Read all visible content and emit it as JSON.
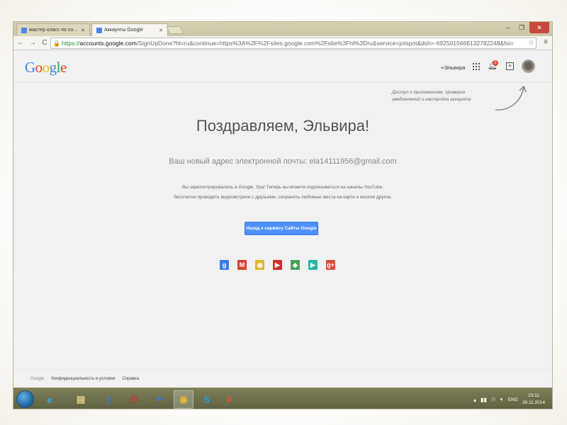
{
  "browser": {
    "tabs": [
      {
        "label": "мастер класс по создан",
        "active": false
      },
      {
        "label": "Аккаунты Google",
        "active": true
      }
    ],
    "window_controls": {
      "minimize": "–",
      "maximize": "❐",
      "close": "✕"
    },
    "nav": {
      "back": "←",
      "forward": "→",
      "reload": "C"
    },
    "address": {
      "scheme": "https://",
      "host": "accounts.google.com",
      "rest": "/SignUpDone?hl=ru&continue=https%3A%2F%2Fsites.google.com%2Fsite%3Fhl%3Dru&service=jotspot&dsh=-6925015666132782248&fvi="
    }
  },
  "header": {
    "logo_letters": [
      {
        "ch": "G",
        "color": "#4285f4"
      },
      {
        "ch": "o",
        "color": "#ea4335"
      },
      {
        "ch": "o",
        "color": "#fbbc05"
      },
      {
        "ch": "g",
        "color": "#4285f4"
      },
      {
        "ch": "l",
        "color": "#34a853"
      },
      {
        "ch": "e",
        "color": "#ea4335"
      }
    ],
    "user_link": "+Эльвира",
    "notification_count": "3"
  },
  "hint": {
    "line1": "Доступ к приложениям, проверка",
    "line2": "уведомлений и настройка аккаунта"
  },
  "main": {
    "title": "Поздравляем, Эльвира!",
    "email_line": "Ваш новый адрес электронной почты: ela14111956@gmail.com",
    "desc_line1": "Вы зарегистрировались в Google. Ура! Теперь вы можете подписываться на каналы YouTube,",
    "desc_line2": "бесплатно проводить видеовстречи с друзьями, сохранять любимые места на карте и многое другое.",
    "back_button": "Назад к сервису Сайты Google"
  },
  "services": [
    {
      "name": "google-plus-blue",
      "glyph": "g",
      "color": "#3c7ee8"
    },
    {
      "name": "gmail",
      "glyph": "M",
      "color": "#d9412f"
    },
    {
      "name": "chrome",
      "glyph": "◉",
      "color": "#e4b52d"
    },
    {
      "name": "youtube",
      "glyph": "▶",
      "color": "#d22d2d"
    },
    {
      "name": "maps",
      "glyph": "◆",
      "color": "#4aa15a"
    },
    {
      "name": "play",
      "glyph": "▶",
      "color": "#2bb3a0"
    },
    {
      "name": "google-plus-red",
      "glyph": "g+",
      "color": "#dd4b39"
    }
  ],
  "footer": {
    "google": "Google",
    "privacy": "Конфиденциальность и условия",
    "help": "Справка"
  },
  "taskbar": {
    "apps": [
      {
        "name": "internet-explorer",
        "glyph": "e",
        "color": "#3ea5e8"
      },
      {
        "name": "file-explorer",
        "glyph": "▤",
        "color": "#e9d38a"
      },
      {
        "name": "phone-app",
        "glyph": "▯",
        "color": "#3b7fd1"
      },
      {
        "name": "power-app",
        "glyph": "⏻",
        "color": "#d0312d"
      },
      {
        "name": "paint-app",
        "glyph": "✦",
        "color": "#4a6fd8"
      },
      {
        "name": "chrome",
        "glyph": "◉",
        "color": "#e2b836"
      },
      {
        "name": "skype",
        "glyph": "S",
        "color": "#1fa1e1"
      },
      {
        "name": "powerpoint",
        "glyph": "P",
        "color": "#d75a2b"
      }
    ],
    "language": "ENG",
    "time": "23:11",
    "date": "30.11.2014"
  }
}
